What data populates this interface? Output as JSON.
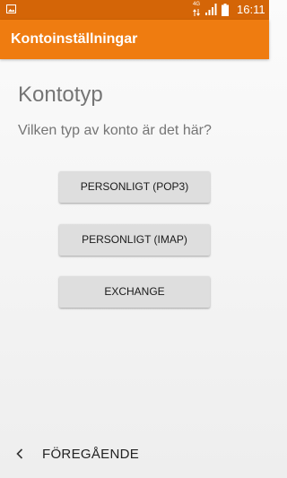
{
  "status_bar": {
    "network_type": "4G",
    "time": "16:11",
    "icons": [
      "image-notification-icon",
      "data-arrows-icon",
      "signal-icon",
      "battery-icon"
    ],
    "background_color": "#d46507"
  },
  "app_bar": {
    "title": "Kontoinställningar",
    "background_color": "#ef7c10"
  },
  "main": {
    "heading": "Kontotyp",
    "question": "Vilken typ av konto är det här?",
    "buttons": [
      {
        "label": "PERSONLIGT (POP3)"
      },
      {
        "label": "PERSONLIGT (IMAP)"
      },
      {
        "label": "EXCHANGE"
      }
    ]
  },
  "bottom_nav": {
    "back_label": "FÖREGÅENDE",
    "back_icon": "chevron-left-icon"
  }
}
